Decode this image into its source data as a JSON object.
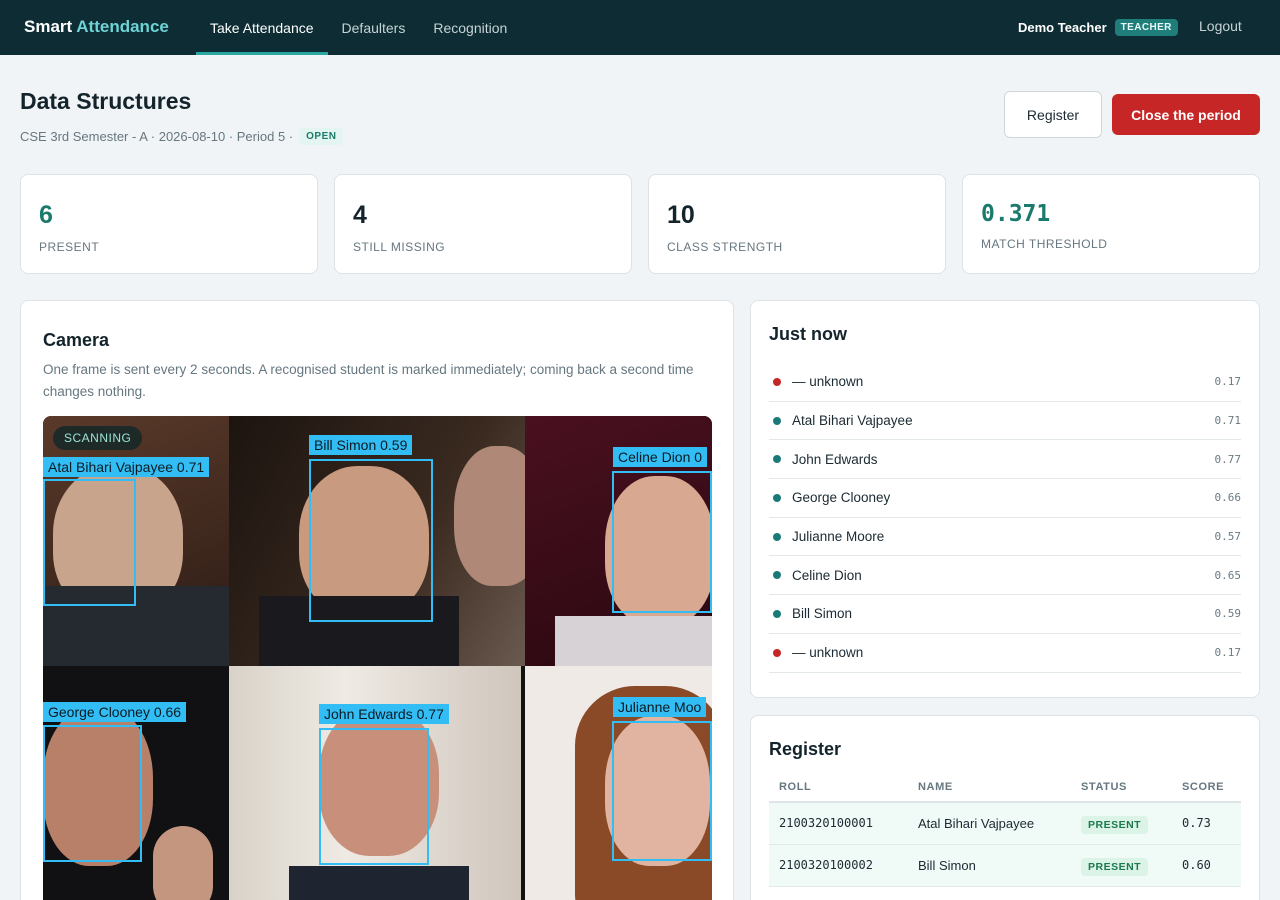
{
  "app": {
    "brand_main": "Smart",
    "brand_accent": "Attendance"
  },
  "nav": {
    "items": [
      {
        "label": "Take Attendance"
      },
      {
        "label": "Defaulters"
      },
      {
        "label": "Recognition"
      }
    ]
  },
  "user": {
    "name": "Demo Teacher",
    "role": "TEACHER",
    "logout_label": "Logout"
  },
  "session": {
    "title": "Data Structures",
    "meta": "CSE 3rd Semester - A · 2026-08-10 · Period 5 ·",
    "status": "OPEN",
    "register_label": "Register",
    "close_label": "Close the period"
  },
  "stats": [
    {
      "value": "6",
      "label": "PRESENT"
    },
    {
      "value": "4",
      "label": "STILL MISSING"
    },
    {
      "value": "10",
      "label": "CLASS STRENGTH"
    },
    {
      "value": "0.371",
      "label": "MATCH THRESHOLD"
    }
  ],
  "camera": {
    "title": "Camera",
    "description": "One frame is sent every 2 seconds. A recognised student is marked immediately; coming back a second time changes nothing.",
    "badge": "SCANNING",
    "detections": [
      "Atal Bihari Vajpayee  0.71",
      "Bill Simon  0.59",
      "Celine Dion  0",
      "George Clooney  0.66",
      "John Edwards  0.77",
      "Julianne Moo"
    ]
  },
  "just_now": {
    "title": "Just now",
    "items": [
      {
        "name": "— unknown",
        "score": "0.17",
        "color": "#c62626"
      },
      {
        "name": "Atal Bihari Vajpayee",
        "score": "0.71",
        "color": "#1a7a7a"
      },
      {
        "name": "John Edwards",
        "score": "0.77",
        "color": "#1a7a7a"
      },
      {
        "name": "George Clooney",
        "score": "0.66",
        "color": "#1a7a7a"
      },
      {
        "name": "Julianne Moore",
        "score": "0.57",
        "color": "#1a7a7a"
      },
      {
        "name": "Celine Dion",
        "score": "0.65",
        "color": "#1a7a7a"
      },
      {
        "name": "Bill Simon",
        "score": "0.59",
        "color": "#1a7a7a"
      },
      {
        "name": "— unknown",
        "score": "0.17",
        "color": "#c62626"
      }
    ]
  },
  "register": {
    "title": "Register",
    "columns": [
      "ROLL",
      "NAME",
      "STATUS",
      "SCORE"
    ],
    "rows": [
      {
        "roll": "2100320100001",
        "name": "Atal Bihari Vajpayee",
        "status": "PRESENT",
        "score": "0.73"
      },
      {
        "roll": "2100320100002",
        "name": "Bill Simon",
        "status": "PRESENT",
        "score": "0.60"
      }
    ]
  }
}
